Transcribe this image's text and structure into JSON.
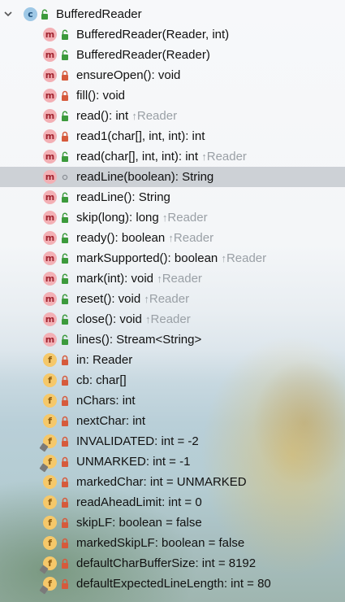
{
  "class": {
    "name": "BufferedReader",
    "icon": "class-icon",
    "expanded": true
  },
  "members": [
    {
      "kind": "method",
      "access": "public",
      "text": "BufferedReader(Reader, int)",
      "inherited": ""
    },
    {
      "kind": "method",
      "access": "public",
      "text": "BufferedReader(Reader)",
      "inherited": ""
    },
    {
      "kind": "method",
      "access": "private",
      "text": "ensureOpen(): void",
      "inherited": ""
    },
    {
      "kind": "method",
      "access": "private",
      "text": "fill(): void",
      "inherited": ""
    },
    {
      "kind": "method",
      "access": "public",
      "text": "read(): int",
      "inherited": "Reader"
    },
    {
      "kind": "method",
      "access": "private",
      "text": "read1(char[], int, int): int",
      "inherited": ""
    },
    {
      "kind": "method",
      "access": "public",
      "text": "read(char[], int, int): int",
      "inherited": "Reader"
    },
    {
      "kind": "method",
      "access": "package",
      "text": "readLine(boolean): String",
      "inherited": "",
      "selected": true
    },
    {
      "kind": "method",
      "access": "public",
      "text": "readLine(): String",
      "inherited": ""
    },
    {
      "kind": "method",
      "access": "public",
      "text": "skip(long): long",
      "inherited": "Reader"
    },
    {
      "kind": "method",
      "access": "public",
      "text": "ready(): boolean",
      "inherited": "Reader"
    },
    {
      "kind": "method",
      "access": "public",
      "text": "markSupported(): boolean",
      "inherited": "Reader"
    },
    {
      "kind": "method",
      "access": "public",
      "text": "mark(int): void",
      "inherited": "Reader"
    },
    {
      "kind": "method",
      "access": "public",
      "text": "reset(): void",
      "inherited": "Reader"
    },
    {
      "kind": "method",
      "access": "public",
      "text": "close(): void",
      "inherited": "Reader"
    },
    {
      "kind": "method",
      "access": "public",
      "text": "lines(): Stream<String>",
      "inherited": ""
    },
    {
      "kind": "field",
      "access": "private",
      "text": "in: Reader",
      "inherited": ""
    },
    {
      "kind": "field",
      "access": "private",
      "text": "cb: char[]",
      "inherited": ""
    },
    {
      "kind": "field",
      "access": "private",
      "text": "nChars: int",
      "inherited": ""
    },
    {
      "kind": "field",
      "access": "private",
      "text": "nextChar: int",
      "inherited": ""
    },
    {
      "kind": "field",
      "access": "private",
      "text": "INVALIDATED: int = -2",
      "inherited": "",
      "static": true
    },
    {
      "kind": "field",
      "access": "private",
      "text": "UNMARKED: int = -1",
      "inherited": "",
      "static": true
    },
    {
      "kind": "field",
      "access": "private",
      "text": "markedChar: int = UNMARKED",
      "inherited": ""
    },
    {
      "kind": "field",
      "access": "private",
      "text": "readAheadLimit: int = 0",
      "inherited": ""
    },
    {
      "kind": "field",
      "access": "private",
      "text": "skipLF: boolean = false",
      "inherited": ""
    },
    {
      "kind": "field",
      "access": "private",
      "text": "markedSkipLF: boolean = false",
      "inherited": ""
    },
    {
      "kind": "field",
      "access": "private",
      "text": "defaultCharBufferSize: int = 8192",
      "inherited": "",
      "static": true
    },
    {
      "kind": "field",
      "access": "private",
      "text": "defaultExpectedLineLength: int = 80",
      "inherited": "",
      "static": true
    }
  ],
  "icons": {
    "method_letter": "m",
    "field_letter": "f",
    "class_letter": "c",
    "inherited_arrow": "↑"
  },
  "colors": {
    "public_lock": "#3c9a3c",
    "private_lock": "#d65a3c",
    "package_dot": "#8a8f96",
    "selection": "#c6cad0",
    "inherited_text": "#9aa0a6"
  }
}
